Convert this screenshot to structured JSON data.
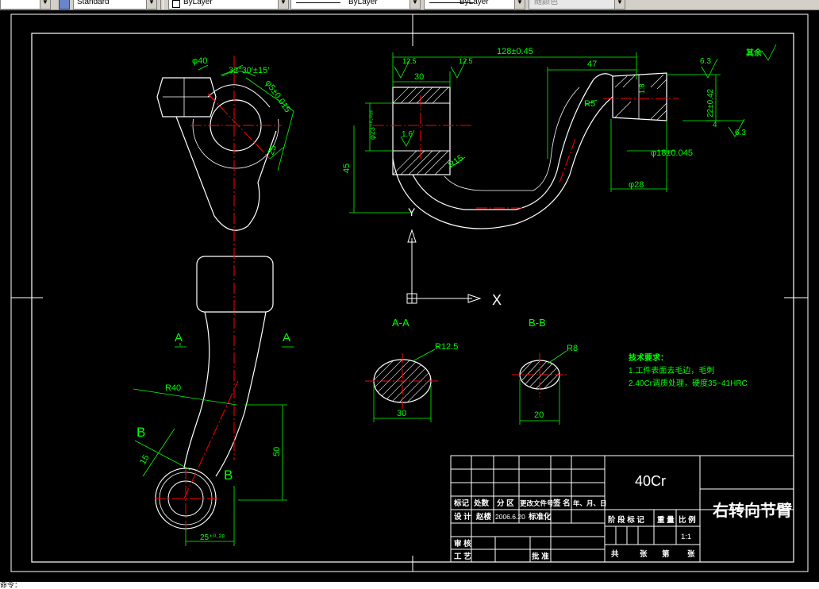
{
  "toolbar": {
    "first_combo_tail": "",
    "text_style": "Standard",
    "layer": "ByLayer",
    "linetype": "ByLayer",
    "lineweight": "ByLayer",
    "plot_style": "随颜色"
  },
  "drawing": {
    "top_view": {
      "phi40": "φ40",
      "angle": "32°30′±15′",
      "dim_phi_015": "φ5±0.015",
      "dim_25": "25",
      "section_a_left": "A",
      "section_a_right": "A",
      "r40": "R40",
      "section_b_left": "B",
      "section_b_right": "B",
      "dim_15": "15",
      "dim_50": "50",
      "dim_25_bottom": "25⁺⁰·²⁸"
    },
    "front_view": {
      "dim_128": "128±0.45",
      "dim_47": "47",
      "dim_30": "30",
      "rough_left": "12.5",
      "rough_mid": "12.5",
      "rough_right": "6.3",
      "rough_right_b": "6.3",
      "rough_inner": "1.6",
      "phi23": "φ23⁺⁰·⁰³³",
      "dim_45": "45",
      "r15": "R15",
      "r5": "R5",
      "taper": "1:8",
      "dim_22": "22±0.42",
      "dim_4": "4",
      "phi18": "φ18±0.045",
      "phi28": "φ28",
      "rest_label": "其余"
    },
    "ucs": {
      "y": "Y",
      "x": "X"
    },
    "sections": {
      "aa_title": "A-A",
      "bb_title": "B-B",
      "r12_5": "R12.5",
      "r8": "R8",
      "dim_30": "30",
      "dim_20": "20"
    },
    "tech_req": {
      "title": "技术要求：",
      "line1": "1.工件表面去毛边，毛刺",
      "line2": "2.40Cr调质处理，硬度35~41HRC"
    },
    "title_block": {
      "material": "40Cr",
      "part_name": "右转向节臂",
      "h_biaoji": "标记",
      "h_chushu": "处数",
      "h_fenqu": "分 区",
      "h_gengai": "更改文件号",
      "h_qianming": "签 名",
      "h_date": "年、月、日",
      "sheji": "设 计",
      "designer": "赵楼",
      "design_date": "2006.6.20",
      "biaozhunhua": "标准化",
      "jieduan": "阶 段 标 记",
      "zhongliang": "重 量",
      "bili": "比 例",
      "scale": "1:1",
      "shenhe": "审 核",
      "gongyi": "工 艺",
      "pizhun": "批 准",
      "gong": "共",
      "zhang1": "张",
      "di": "第",
      "zhang2": "张"
    }
  },
  "command_line": {
    "text": "命令："
  },
  "colors": {
    "background": "#000000",
    "outline": "#ffffff",
    "center": "#ff0000",
    "dimension": "#00ff00",
    "text_green": "#00ff00",
    "toolbar": "#d4d0c8"
  }
}
